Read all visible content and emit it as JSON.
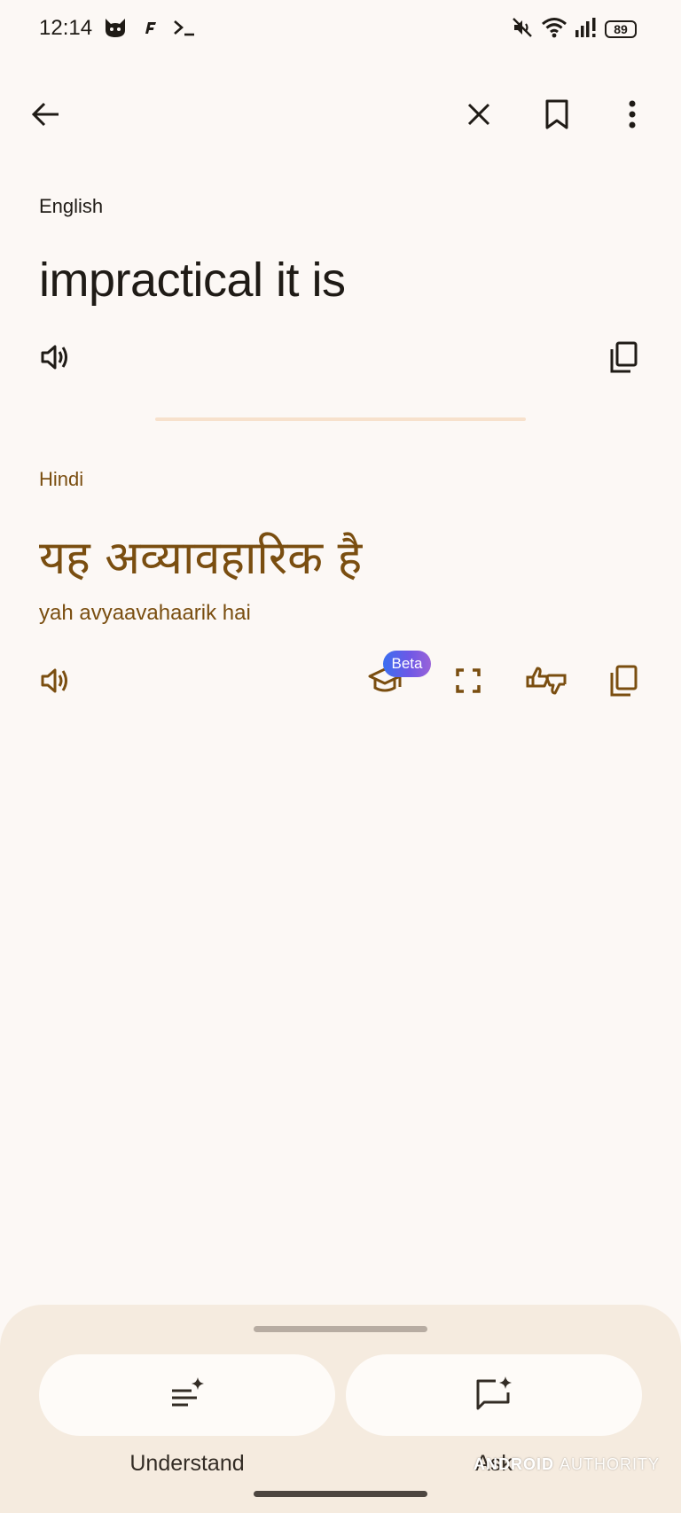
{
  "status_bar": {
    "time": "12:14",
    "battery": "89",
    "icons": [
      "cat-app-icon",
      "f-app-icon",
      "terminal-icon",
      "mute-icon",
      "wifi-icon",
      "signal-icon"
    ]
  },
  "top_bar": {
    "icons": [
      "back-arrow-icon",
      "close-icon",
      "bookmark-icon",
      "more-vert-icon"
    ]
  },
  "source": {
    "language": "English",
    "text": "impractical it is"
  },
  "target": {
    "language": "Hindi",
    "text": "यह अव्यावहारिक है",
    "transliteration": "yah avyaavahaarik hai",
    "beta_badge": "Beta"
  },
  "bottom_sheet": {
    "understand_label": "Understand",
    "ask_label": "Ask"
  },
  "watermark": {
    "bold": "ANDROID",
    "light": "AUTHORITY"
  },
  "colors": {
    "background": "#fcf8f5",
    "accent_brown": "#7a4e10",
    "sheet": "#f5ebdf",
    "divider": "#f7e1cc"
  }
}
